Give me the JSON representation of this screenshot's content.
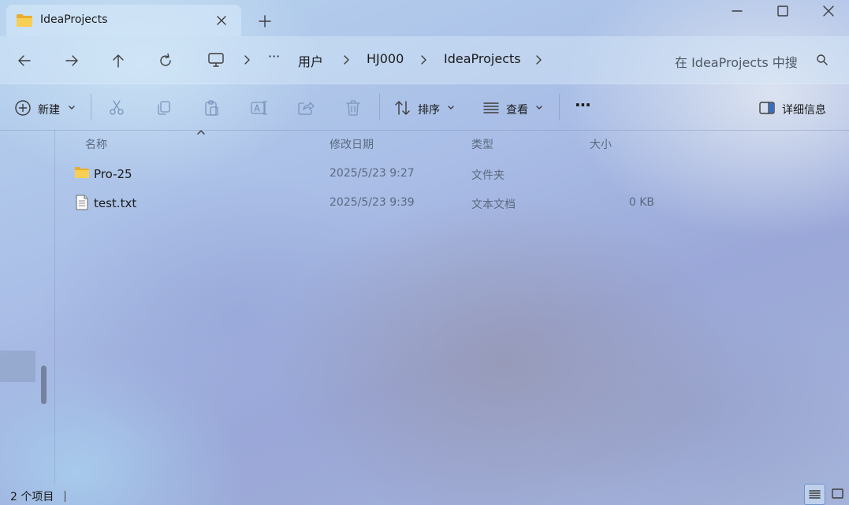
{
  "window": {
    "tab_title": "IdeaProjects",
    "tab_icon": "folder-icon",
    "new_tab_glyph": "+",
    "controls": [
      "minimize-icon",
      "maximize-icon",
      "close-icon"
    ]
  },
  "address_bar": {
    "nav_buttons": [
      "back-arrow-icon",
      "forward-arrow-icon",
      "up-arrow-icon",
      "refresh-icon"
    ],
    "root_icon": "monitor-icon",
    "ellipsis": "···",
    "breadcrumbs": [
      "用户",
      "HJ000",
      "IdeaProjects"
    ],
    "search_placeholder": "在 IdeaProjects 中搜",
    "search_icon": "search-icon"
  },
  "command_bar": {
    "new_label": "新建",
    "sort_label": "排序",
    "view_label": "查看",
    "more_glyph": "···",
    "details_label": "详细信息",
    "disabled_tools": [
      "cut-icon",
      "copy-icon",
      "paste-icon",
      "rename-icon",
      "share-icon",
      "delete-icon"
    ]
  },
  "file_list": {
    "columns": {
      "name": "名称",
      "date": "修改日期",
      "type": "类型",
      "size": "大小"
    },
    "rows": [
      {
        "name": "Pro-25",
        "date": "2025/5/23 9:27",
        "type": "文件夹",
        "size": "",
        "icon": "folder-icon"
      },
      {
        "name": "test.txt",
        "date": "2025/5/23 9:39",
        "type": "文本文档",
        "size": "0 KB",
        "icon": "text-file-icon"
      }
    ]
  },
  "status_bar": {
    "item_count": "2 个项目"
  },
  "colors": {
    "folder_yellow": "#f4c542",
    "accent_blue": "#2f6fd0",
    "disabled_icon": "#7b95bd"
  }
}
